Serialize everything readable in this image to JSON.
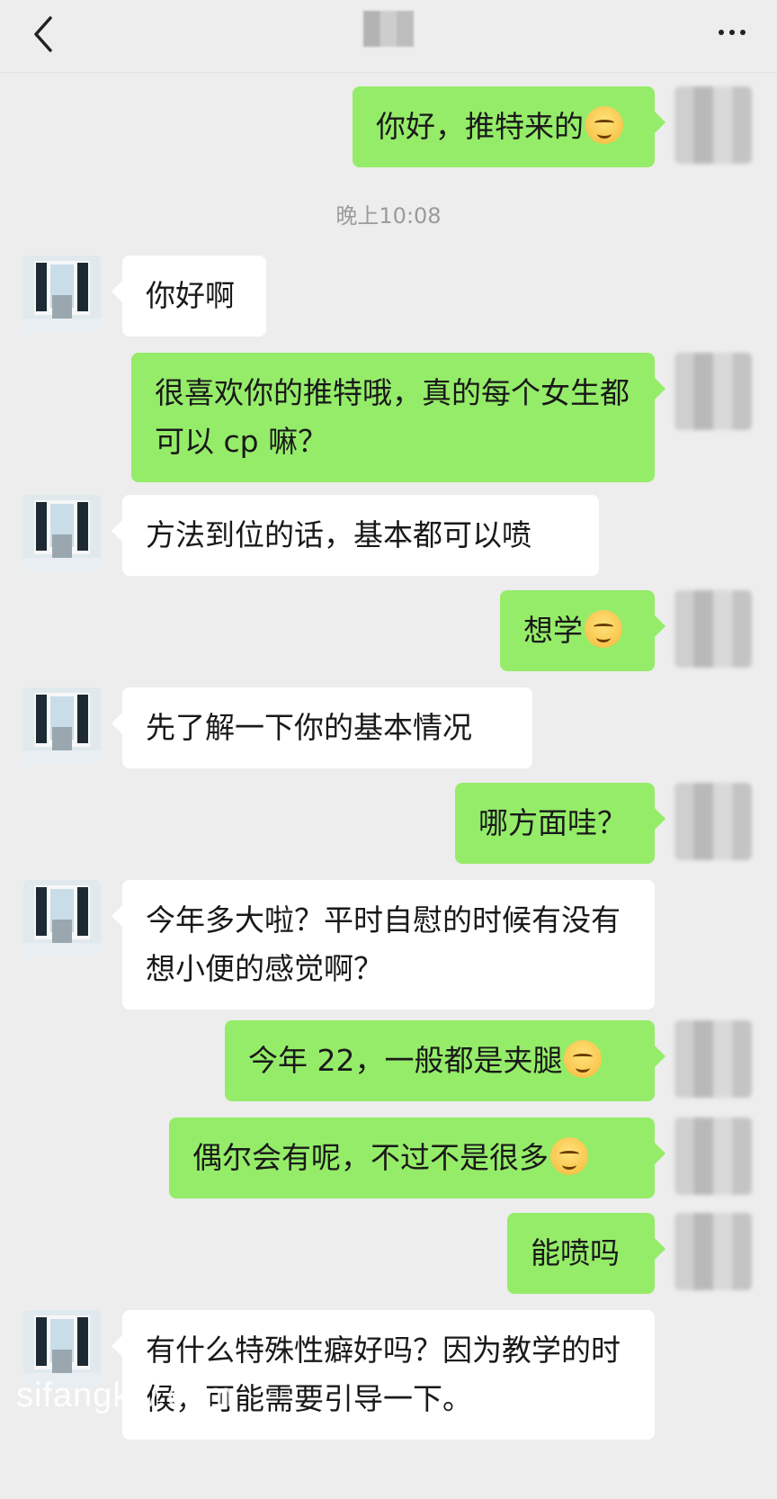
{
  "header": {
    "back_label": "<",
    "more_label": "···"
  },
  "timestamp": "晚上10:08",
  "messages": [
    {
      "from": "me",
      "text": "你好，推特来的",
      "emoji": "smile"
    },
    {
      "from": "other",
      "text": "你好啊"
    },
    {
      "from": "me",
      "text": "很喜欢你的推特哦，真的每个女生都可以 cp 嘛？"
    },
    {
      "from": "other",
      "text": "方法到位的话，基本都可以喷"
    },
    {
      "from": "me",
      "text": "想学",
      "emoji": "shy"
    },
    {
      "from": "other",
      "text": "先了解一下你的基本情况"
    },
    {
      "from": "me",
      "text": "哪方面哇？"
    },
    {
      "from": "other",
      "text": "今年多大啦？平时自慰的时候有没有想小便的感觉啊？"
    },
    {
      "from": "me",
      "text": "今年 22，一般都是夹腿",
      "emoji": "shy"
    },
    {
      "from": "me",
      "text": "偶尔会有呢，不过不是很多",
      "emoji": "blush"
    },
    {
      "from": "me",
      "text": "能喷吗"
    },
    {
      "from": "other",
      "text": "有什么特殊性癖好吗？因为教学的时候，可能需要引导一下。"
    }
  ],
  "watermark": "sifangktv.com"
}
